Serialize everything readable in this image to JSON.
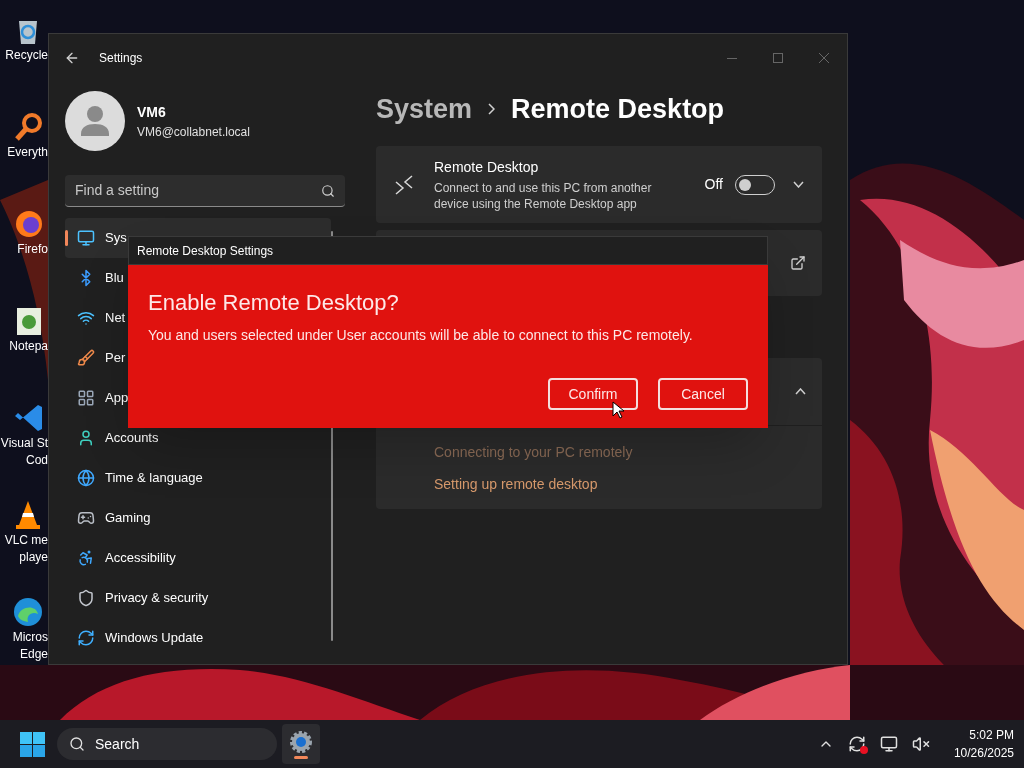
{
  "desktop_icons": [
    {
      "kind": "recycle",
      "lines": [
        "Recycle"
      ]
    },
    {
      "kind": "magnifier",
      "lines": [
        "Everyth"
      ]
    },
    {
      "kind": "browser",
      "lines": [
        "Firefo"
      ]
    },
    {
      "kind": "notepad",
      "lines": [
        "Notepa"
      ]
    },
    {
      "kind": "code",
      "lines": [
        "Visual St",
        "Cod"
      ]
    },
    {
      "kind": "cone",
      "lines": [
        "VLC me",
        "playe"
      ]
    },
    {
      "kind": "edge",
      "lines": [
        "Micros",
        "Edge"
      ]
    }
  ],
  "window": {
    "title": "Settings",
    "user": {
      "name": "VM6",
      "email": "VM6@collabnet.local"
    },
    "search": {
      "placeholder": "Find a setting"
    },
    "nav": [
      {
        "kind": "display",
        "label": "Sys",
        "selected": true
      },
      {
        "kind": "bluetooth",
        "label": "Blu",
        "selected": false
      },
      {
        "kind": "wifi",
        "label": "Net",
        "selected": false
      },
      {
        "kind": "brush",
        "label": "Per",
        "selected": false
      },
      {
        "kind": "apps",
        "label": "App",
        "selected": false
      },
      {
        "kind": "person",
        "label": "Accounts",
        "selected": false
      },
      {
        "kind": "globe",
        "label": "Time & language",
        "selected": false
      },
      {
        "kind": "gamepad",
        "label": "Gaming",
        "selected": false
      },
      {
        "kind": "figure",
        "label": "Accessibility",
        "selected": false
      },
      {
        "kind": "shield",
        "label": "Privacy & security",
        "selected": false
      },
      {
        "kind": "update",
        "label": "Windows Update",
        "selected": false
      }
    ],
    "breadcrumb": [
      "System",
      "Remote Desktop"
    ],
    "remote_card": {
      "title": "Remote Desktop",
      "description": "Connect to and use this PC from another device using the Remote Desktop app",
      "state_label": "Off",
      "on": false,
      "expanded": false
    },
    "help_card": {
      "expanded": true,
      "links": [
        "Connecting to your PC remotely",
        "Setting up remote desktop"
      ]
    }
  },
  "dialog": {
    "title": "Remote Desktop Settings",
    "heading": "Enable Remote Desktop?",
    "message": "You and users selected under User accounts will be able to connect to this PC remotely.",
    "buttons": [
      "Confirm",
      "Cancel"
    ]
  },
  "taskbar": {
    "search": "Search",
    "time": "5:02 PM",
    "date": "10/26/2025"
  }
}
